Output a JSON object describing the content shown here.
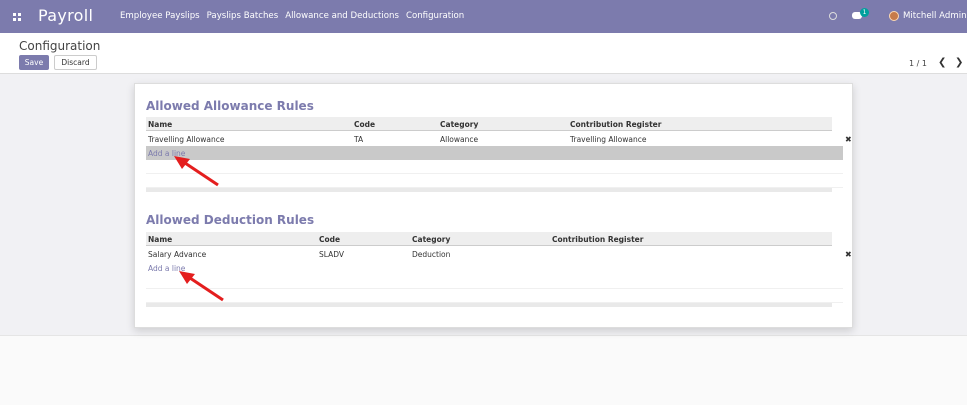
{
  "app": {
    "title": "Payroll"
  },
  "menu": [
    "Employee Payslips",
    "Payslips Batches",
    "Allowance and Deductions",
    "Configuration"
  ],
  "systray": {
    "chat_count": "1",
    "user_name": "Mitchell Admin"
  },
  "control_panel": {
    "breadcrumb": "Configuration",
    "save_label": "Save",
    "discard_label": "Discard",
    "pager": "1 / 1"
  },
  "allowance_section": {
    "title": "Allowed Allowance Rules",
    "columns": [
      "Name",
      "Code",
      "Category",
      "Contribution Register"
    ],
    "rows": [
      {
        "name": "Travelling Allowance",
        "code": "TA",
        "category": "Allowance",
        "register": "Travelling Allowance"
      }
    ],
    "add_label": "Add a line"
  },
  "deduction_section": {
    "title": "Allowed Deduction Rules",
    "columns": [
      "Name",
      "Code",
      "Category",
      "Contribution Register"
    ],
    "rows": [
      {
        "name": "Salary Advance",
        "code": "SLADV",
        "category": "Deduction",
        "register": ""
      }
    ],
    "add_label": "Add a line"
  },
  "icons": {
    "delete": "times-icon",
    "pager_prev": "chevron-left-icon",
    "pager_next": "chevron-right-icon"
  },
  "colors": {
    "brand": "#7c7bad",
    "annotation": "#e41e1e"
  }
}
